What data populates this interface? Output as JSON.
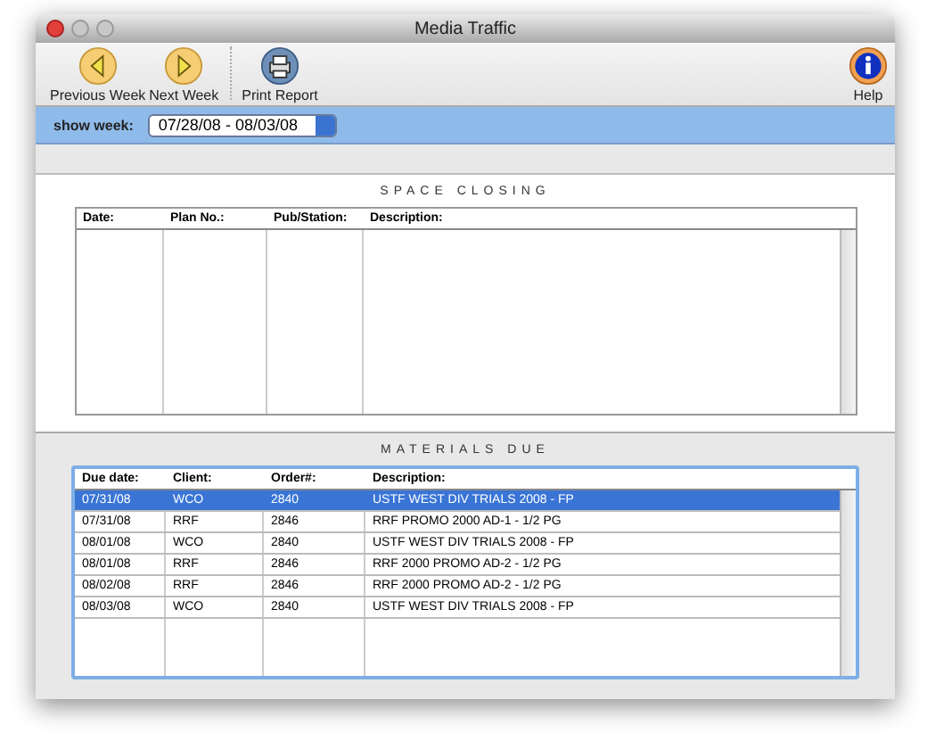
{
  "window": {
    "title": "Media Traffic"
  },
  "toolbar": {
    "buttons": [
      {
        "label": "Previous Week",
        "kind": "prev"
      },
      {
        "label": "Next Week",
        "kind": "next"
      },
      {
        "label": "Print Report",
        "kind": "print"
      }
    ],
    "help": {
      "label": "Help"
    }
  },
  "filter": {
    "label": "show week:",
    "value": "07/28/08 - 08/03/08"
  },
  "space_closing": {
    "title": "SPACE CLOSING",
    "columns": [
      "Date:",
      "Plan No.:",
      "Pub/Station:",
      "Description:"
    ]
  },
  "materials_due": {
    "title": "MATERIALS DUE",
    "columns": [
      "Due date:",
      "Client:",
      "Order#:",
      "Description:"
    ],
    "rows": [
      {
        "cells": [
          "07/31/08",
          "WCO",
          "2840",
          "USTF WEST DIV TRIALS 2008 - FP"
        ],
        "selected": true
      },
      {
        "cells": [
          "07/31/08",
          "RRF",
          "2846",
          "RRF PROMO 2000 AD-1 - 1/2 PG"
        ],
        "selected": false
      },
      {
        "cells": [
          "08/01/08",
          "WCO",
          "2840",
          "USTF WEST DIV TRIALS 2008 - FP"
        ],
        "selected": false
      },
      {
        "cells": [
          "08/01/08",
          "RRF",
          "2846",
          "RRF 2000 PROMO AD-2 - 1/2 PG"
        ],
        "selected": false
      },
      {
        "cells": [
          "08/02/08",
          "RRF",
          "2846",
          "RRF 2000 PROMO AD-2 - 1/2 PG"
        ],
        "selected": false
      },
      {
        "cells": [
          "08/03/08",
          "WCO",
          "2840",
          "USTF WEST DIV TRIALS 2008 - FP"
        ],
        "selected": false
      }
    ]
  }
}
